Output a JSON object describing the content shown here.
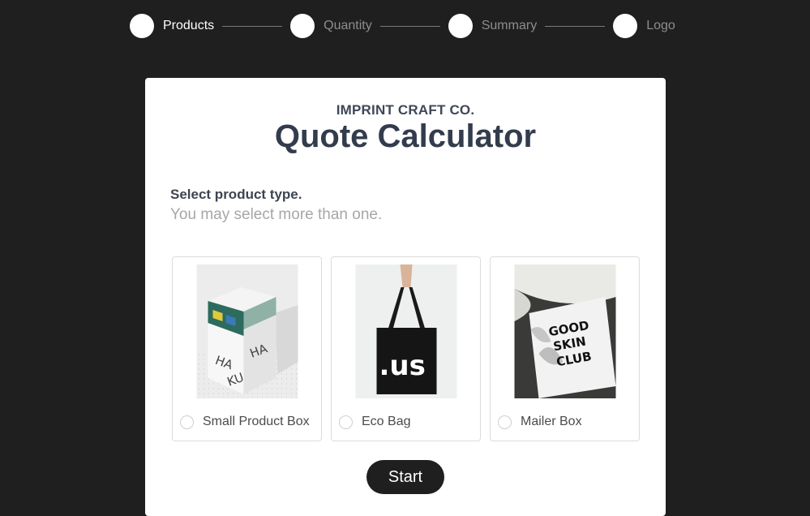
{
  "stepper": {
    "steps": [
      {
        "label": "Products",
        "active": true
      },
      {
        "label": "Quantity",
        "active": false
      },
      {
        "label": "Summary",
        "active": false
      },
      {
        "label": "Logo",
        "active": false
      }
    ]
  },
  "card": {
    "brand": "IMPRINT CRAFT CO.",
    "title": "Quote Calculator",
    "prompt": "Select product type.",
    "prompt_sub": "You may select more than one.",
    "options": [
      {
        "label": "Small Product Box",
        "selected": false,
        "image": "product-box-photo"
      },
      {
        "label": "Eco Bag",
        "selected": false,
        "image": "tote-bag-photo"
      },
      {
        "label": "Mailer Box",
        "selected": false,
        "image": "mailer-box-photo"
      }
    ],
    "start_label": "Start"
  },
  "images": {
    "bag_text": ".us",
    "mailer_text": [
      "GOOD",
      "SKIN",
      "CLUB"
    ],
    "box_text": [
      "HA",
      "KU",
      "HA"
    ]
  },
  "colors": {
    "background": "#1f1f20",
    "card": "#ffffff",
    "title": "#333c4d",
    "muted": "#a7a7a7",
    "button": "#1f1f20"
  }
}
